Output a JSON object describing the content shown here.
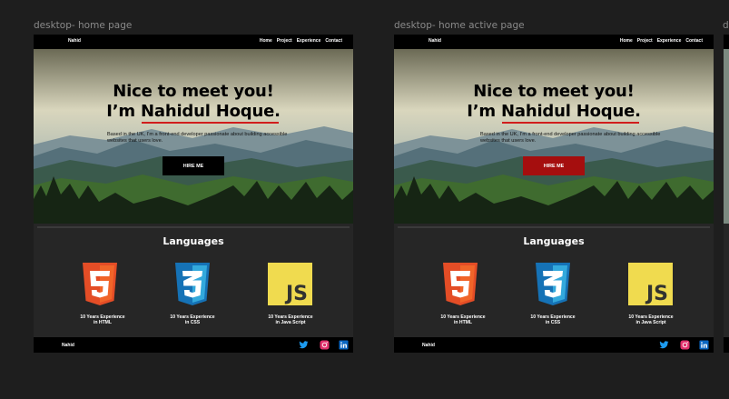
{
  "frame1": {
    "label": "desktop- home page",
    "nav": {
      "logo": "Nahid",
      "links": [
        "Home",
        "Project",
        "Experience",
        "Contact"
      ]
    },
    "hero": {
      "title_line1": "Nice to meet you!",
      "title_line2": "I’m Nahidul Hoque.",
      "description": "Based in the UK, I’m a front-end developer passionate about building accessible websites that users love.",
      "button_label": "HIRE ME",
      "button_color": "#000000"
    },
    "languages": {
      "title": "Languages",
      "items": [
        {
          "icon": "html5-icon",
          "text_line1": "10 Years Experience",
          "text_line2": "in HTML"
        },
        {
          "icon": "css3-icon",
          "text_line1": "10 Years Experience",
          "text_line2": "in CSS"
        },
        {
          "icon": "javascript-icon",
          "text_line1": "10 Years Experience",
          "text_line2": "in Java Script"
        }
      ]
    },
    "footer": {
      "logo": "Nahid",
      "social": [
        "twitter-icon",
        "instagram-icon",
        "linkedin-icon"
      ]
    }
  },
  "frame2": {
    "label": "desktop- home active page",
    "nav": {
      "logo": "Nahid",
      "links": [
        "Home",
        "Project",
        "Experience",
        "Contact"
      ]
    },
    "hero": {
      "title_line1": "Nice to meet you!",
      "title_line2": "I’m Nahidul Hoque.",
      "description": "Based in the UK, I’m a front-end developer passionate about building accessible websites that users love.",
      "button_label": "HIRE ME",
      "button_color": "#a50e0e"
    },
    "languages": {
      "title": "Languages",
      "items": [
        {
          "icon": "html5-icon",
          "text_line1": "10 Years Experience",
          "text_line2": "in HTML"
        },
        {
          "icon": "css3-icon",
          "text_line1": "10 Years Experience",
          "text_line2": "in CSS"
        },
        {
          "icon": "javascript-icon",
          "text_line1": "10 Years Experience",
          "text_line2": "in Java Script"
        }
      ]
    },
    "footer": {
      "logo": "Nahid",
      "social": [
        "twitter-icon",
        "instagram-icon",
        "linkedin-icon"
      ]
    }
  },
  "frame3_label_partial": "d",
  "colors": {
    "canvas": "#1e1e1e",
    "accent_underline": "#d11d1d",
    "html5": "#e44d26",
    "css3": "#1572b6",
    "js": "#f0db4f"
  }
}
